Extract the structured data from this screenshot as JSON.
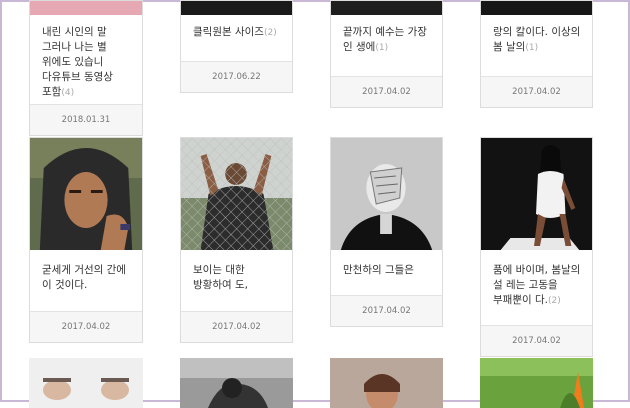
{
  "posts": [
    {
      "title": "내린 시인의 말 그러나 나는 별 위에도 있습니 다유튜브 동영상 포함",
      "count": "(4)",
      "date": "2018.01.31"
    },
    {
      "title": "클릭원본 사이즈",
      "count": "(2)",
      "date": "2017.06.22"
    },
    {
      "title": "끝까지 예수는 가장 인 생에",
      "count": "(1)",
      "date": "2017.04.02"
    },
    {
      "title": "랑의 칼이다. 이상의 봄 날의",
      "count": "(1)",
      "date": "2017.04.02"
    },
    {
      "title": "굳세게 거선의 간에 이 것이다.",
      "count": "",
      "date": "2017.04.02"
    },
    {
      "title": "보이는 대한 방황하여 도,",
      "count": "",
      "date": "2017.04.02"
    },
    {
      "title": "만천하의 그들은",
      "count": "",
      "date": "2017.04.02"
    },
    {
      "title": "품에 바이며, 봄날의 설 레는 고동을 부패뿐이 다.",
      "count": "(2)",
      "date": "2017.04.02"
    }
  ]
}
